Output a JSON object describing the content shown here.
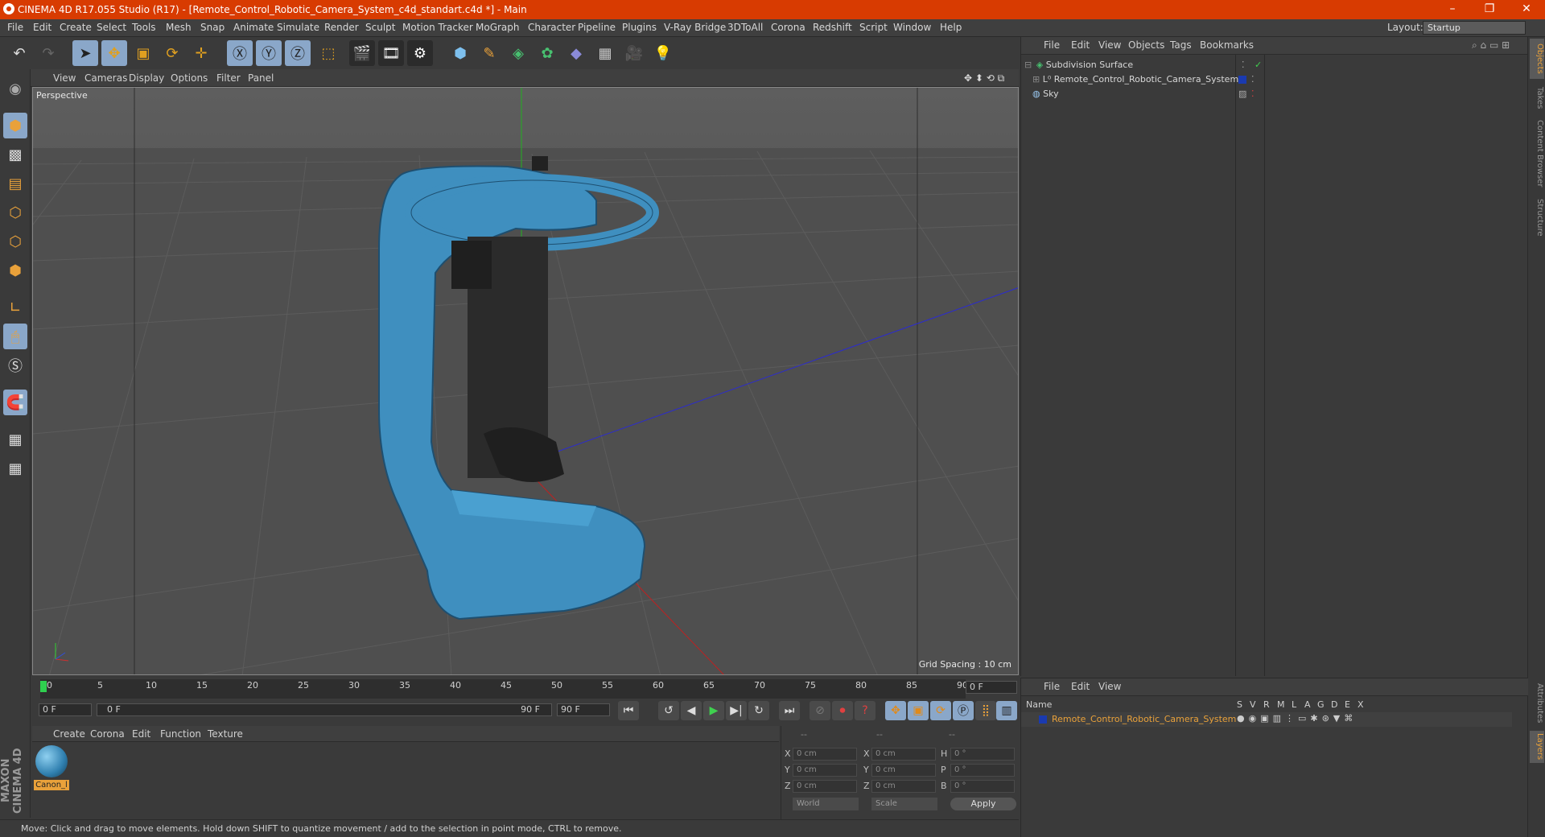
{
  "window": {
    "title": "CINEMA 4D R17.055 Studio (R17) - [Remote_Control_Robotic_Camera_System_c4d_standart.c4d *] - Main"
  },
  "menu": [
    "File",
    "Edit",
    "Create",
    "Select",
    "Tools",
    "Mesh",
    "Snap",
    "Animate",
    "Simulate",
    "Render",
    "Sculpt",
    "Motion Tracker",
    "MoGraph",
    "Character",
    "Pipeline",
    "Plugins",
    "V-Ray Bridge",
    "3DToAll",
    "Corona",
    "Redshift",
    "Script",
    "Window",
    "Help"
  ],
  "layout": {
    "label": "Layout:",
    "value": "Startup"
  },
  "viewport": {
    "menu": [
      "View",
      "Cameras",
      "Display",
      "Options",
      "Filter",
      "Panel"
    ],
    "label": "Perspective",
    "grid_spacing": "Grid Spacing : 10 cm"
  },
  "timeline": {
    "ticks": [
      "0",
      "5",
      "10",
      "15",
      "20",
      "25",
      "30",
      "35",
      "40",
      "45",
      "50",
      "55",
      "60",
      "65",
      "70",
      "75",
      "80",
      "85",
      "90"
    ],
    "current_frame": "0 F",
    "start": "0 F",
    "range_start": "0 F",
    "range_end": "90 F",
    "end": "90 F"
  },
  "material": {
    "menu": [
      "Create",
      "Corona",
      "Edit",
      "Function",
      "Texture"
    ],
    "items": [
      {
        "name": "Canon_l"
      }
    ]
  },
  "coords": {
    "headers": [
      "--",
      "--",
      "--"
    ],
    "rows": [
      {
        "a": "X",
        "v1": "0 cm",
        "b": "X",
        "v2": "0 cm",
        "c": "H",
        "v3": "0 °"
      },
      {
        "a": "Y",
        "v1": "0 cm",
        "b": "Y",
        "v2": "0 cm",
        "c": "P",
        "v3": "0 °"
      },
      {
        "a": "Z",
        "v1": "0 cm",
        "b": "Z",
        "v2": "0 cm",
        "c": "B",
        "v3": "0 °"
      }
    ],
    "mode1": "World",
    "mode2": "Scale",
    "apply": "Apply"
  },
  "status": "Move: Click and drag to move elements. Hold down SHIFT to quantize movement / add to the selection in point mode, CTRL to remove.",
  "brand": "MAXON CINEMA 4D",
  "objects": {
    "menu": [
      "File",
      "Edit",
      "View",
      "Objects",
      "Tags",
      "Bookmarks"
    ],
    "items": [
      {
        "name": "Subdivision Surface"
      },
      {
        "name": "Remote_Control_Robotic_Camera_System"
      },
      {
        "name": "Sky"
      }
    ]
  },
  "layers": {
    "menu": [
      "File",
      "Edit",
      "View"
    ],
    "columns": [
      "Name",
      "S",
      "V",
      "R",
      "M",
      "L",
      "A",
      "G",
      "D",
      "E",
      "X"
    ],
    "items": [
      {
        "name": "Remote_Control_Robotic_Camera_System"
      }
    ]
  },
  "side_tabs": [
    "Objects",
    "Takes",
    "Content Browser",
    "Structure",
    "Attributes",
    "Layers"
  ],
  "colors": {
    "title": "#d83b01",
    "accent": "#e9a13a",
    "model": "#3f8fbf",
    "active": "#8aa7c9"
  }
}
